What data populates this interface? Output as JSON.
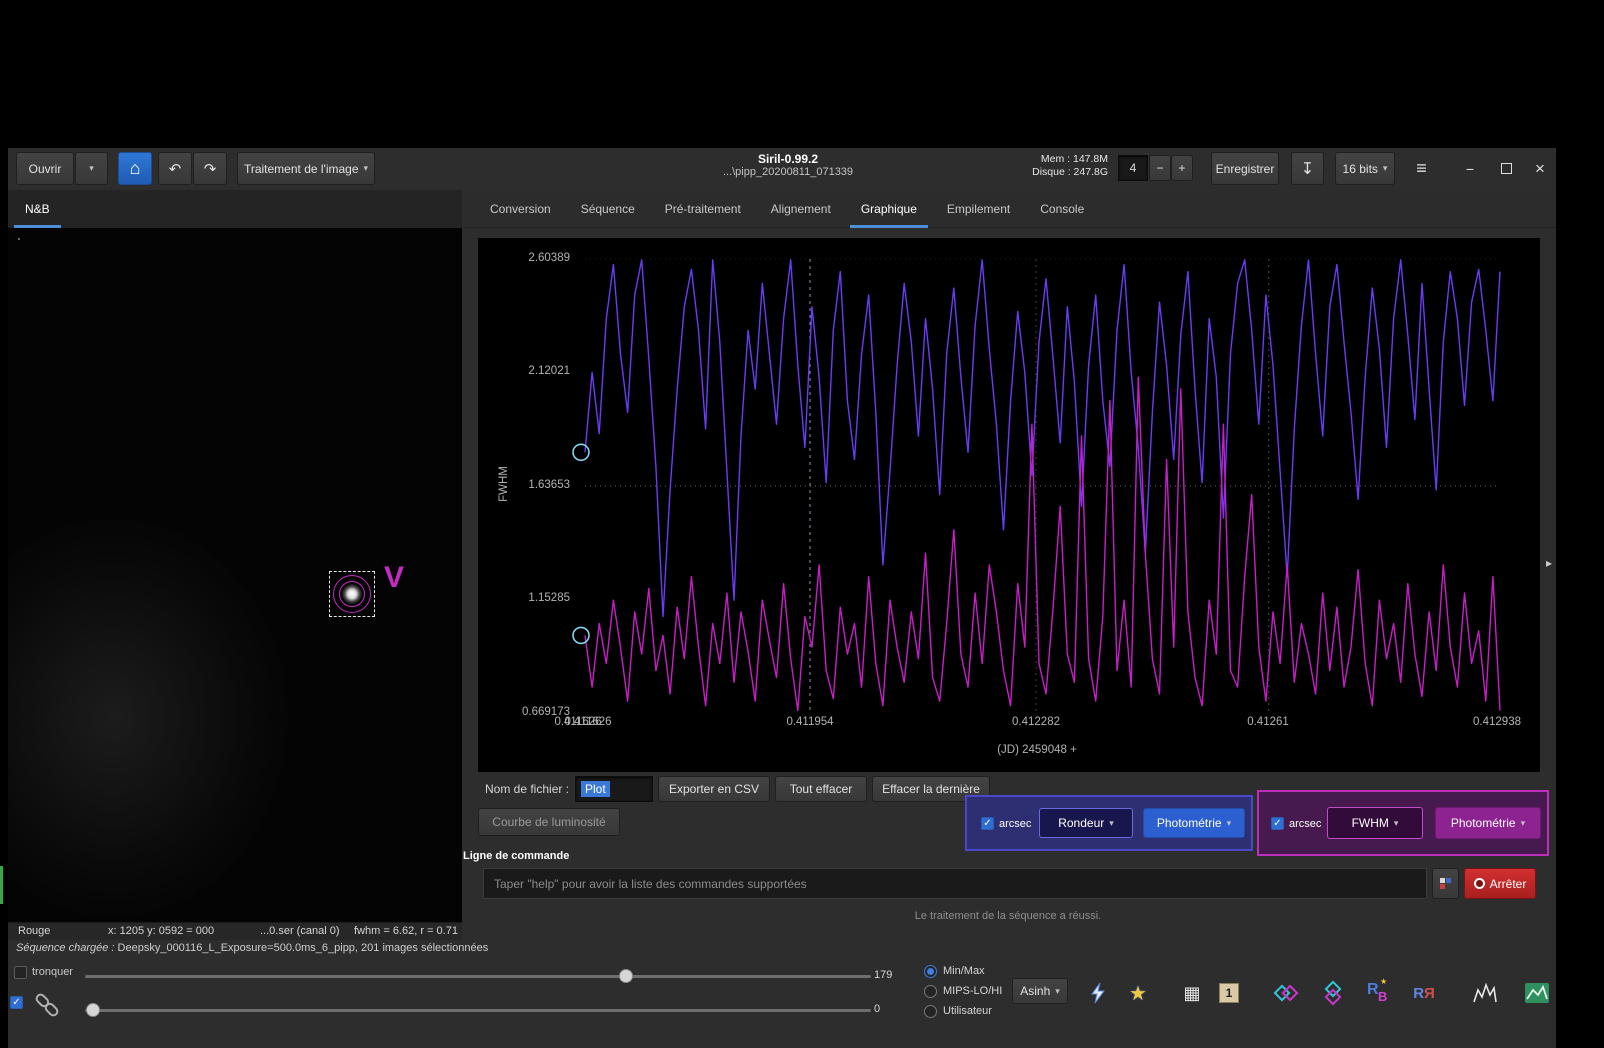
{
  "icons": {
    "caret": "▾",
    "home": "⌂",
    "undo": "↶",
    "redo": "↷",
    "export": "↧",
    "menu": "≡",
    "close": "×",
    "check": "✓",
    "star": "★",
    "grid": "▦",
    "expander": "▸",
    "minus": "−",
    "plus": "+",
    "frame_one": "1",
    "letter_r": "R",
    "letter_b": "B",
    "letter_r_mirrored": "Я"
  },
  "toolbar": {
    "open_label": "Ouvrir",
    "processing_label": "Traitement de l'image",
    "title": "Siril-0.99.2",
    "subtitle": "...\\pipp_20200811_071339",
    "mem": "Mem : 147.8M",
    "disk": "Disque : 247.8G",
    "spin_value": "4",
    "save_label": "Enregistrer",
    "bits_label": "16 bits"
  },
  "left_panel": {
    "tab_label": "N&B",
    "star_annotation": "V",
    "status_channel": "Rouge",
    "status_coords": "x: 1205 y: 0592 = 000",
    "status_file": "...0.ser (canal 0)",
    "status_fwhm": "fwhm = 6.62, r = 0.71",
    "sequence_prefix": "Séquence chargée :",
    "sequence_text": "Deepsky_000116_L_Exposure=500.0ms_6_pipp, 201 images sélectionnées"
  },
  "tabs": [
    "Conversion",
    "Séquence",
    "Pré-traitement",
    "Alignement",
    "Graphique",
    "Empilement",
    "Console"
  ],
  "chart_data": {
    "type": "line",
    "title": "",
    "xlabel": "(JD) 2459048 +",
    "ylabel": "FWHM",
    "x_ticks": [
      "0.411626",
      "0.411954",
      "0.412282",
      "0.41261",
      "0.412938"
    ],
    "y_ticks": [
      "2.60389",
      "2.12021",
      "1.63653",
      "1.15285",
      "0.669173"
    ],
    "xlim": [
      0.411626,
      0.412938
    ],
    "ylim": [
      0.669173,
      2.60389
    ],
    "grid": "dotted",
    "legend_position": "none",
    "marker_color": "#86d4ee",
    "series": [
      {
        "name": "FWHM",
        "color": "#6a3cf5",
        "values": [
          1.78,
          2.12,
          1.86,
          2.35,
          2.58,
          2.2,
          1.95,
          2.45,
          2.6,
          2.18,
          1.72,
          1.08,
          1.62,
          2.05,
          2.4,
          2.56,
          2.3,
          1.88,
          2.6,
          2.25,
          1.7,
          1.15,
          1.85,
          2.3,
          2.05,
          2.5,
          2.2,
          1.9,
          2.35,
          2.6,
          2.15,
          1.8,
          2.4,
          2.1,
          1.65,
          2.3,
          2.55,
          2.0,
          1.75,
          2.2,
          2.45,
          1.95,
          1.3,
          1.7,
          2.15,
          2.5,
          2.25,
          1.85,
          2.35,
          2.05,
          1.6,
          2.2,
          2.48,
          2.1,
          1.78,
          2.32,
          2.6,
          2.22,
          1.9,
          1.45,
          2.0,
          2.38,
          2.12,
          1.68,
          2.25,
          2.52,
          2.18,
          1.82,
          2.4,
          2.08,
          1.55,
          2.15,
          2.45,
          2.0,
          1.72,
          2.3,
          2.58,
          2.12,
          1.8,
          1.35,
          1.95,
          2.42,
          2.15,
          1.75,
          2.28,
          2.55,
          2.05,
          1.65,
          2.35,
          2.1,
          1.5,
          2.2,
          2.5,
          2.6,
          2.3,
          1.9,
          2.45,
          2.15,
          1.7,
          1.25,
          1.88,
          2.32,
          2.6,
          2.2,
          1.85,
          2.4,
          2.58,
          2.25,
          1.95,
          1.58,
          2.1,
          2.48,
          2.22,
          1.8,
          2.35,
          2.6,
          2.28,
          1.92,
          2.5,
          2.05,
          1.62,
          2.25,
          2.55,
          2.35,
          1.98,
          2.42,
          2.56,
          2.3,
          2.0,
          2.55
        ]
      },
      {
        "name": "Rondeur",
        "color": "#c81ec8",
        "values": [
          1.0,
          0.78,
          1.05,
          0.88,
          1.15,
          0.95,
          0.72,
          1.1,
          0.92,
          1.2,
          0.85,
          1.0,
          0.75,
          1.12,
          0.9,
          1.25,
          0.95,
          0.7,
          1.05,
          0.88,
          1.18,
          0.8,
          1.1,
          0.93,
          0.72,
          1.15,
          0.98,
          0.82,
          1.22,
          0.9,
          0.68,
          1.08,
          0.95,
          1.3,
          0.85,
          0.73,
          1.12,
          0.92,
          1.05,
          0.78,
          1.25,
          0.88,
          0.7,
          1.15,
          0.95,
          0.8,
          1.1,
          0.9,
          1.35,
          0.82,
          0.72,
          1.05,
          1.45,
          0.92,
          0.78,
          1.18,
          0.88,
          1.3,
          1.1,
          0.85,
          0.7,
          1.22,
          0.95,
          1.9,
          0.88,
          0.75,
          1.12,
          1.55,
          0.92,
          0.8,
          1.85,
          0.9,
          0.72,
          1.08,
          2.0,
          0.85,
          1.15,
          0.78,
          2.1,
          1.35,
          0.9,
          0.75,
          1.75,
          0.95,
          2.05,
          1.1,
          0.82,
          0.7,
          1.15,
          0.92,
          1.9,
          0.85,
          0.78,
          1.25,
          1.6,
          0.95,
          0.72,
          1.1,
          0.88,
          1.3,
          0.8,
          1.05,
          0.92,
          0.75,
          1.18,
          0.85,
          1.12,
          0.78,
          0.95,
          1.28,
          0.88,
          0.7,
          1.15,
          0.9,
          1.05,
          0.8,
          1.22,
          0.92,
          0.74,
          1.1,
          0.85,
          1.3,
          0.95,
          0.78,
          1.18,
          0.88,
          1.02,
          0.72,
          1.25,
          0.68
        ]
      }
    ]
  },
  "plot_controls": {
    "filename_label": "Nom de fichier :",
    "filename_value": "Plot",
    "export_csv_label": "Exporter en CSV",
    "clear_all_label": "Tout effacer",
    "clear_last_label": "Effacer la dernière",
    "light_curve_label": "Courbe de luminosité"
  },
  "series_panels": {
    "blue_arcsec_label": "arcsec",
    "blue_metric": "Rondeur",
    "blue_source": "Photométrie",
    "purple_arcsec_label": "arcsec",
    "purple_metric": "FWHM",
    "purple_source": "Photométrie"
  },
  "command": {
    "label": "Ligne de commande",
    "placeholder": "Taper \"help\" pour avoir la liste des commandes supportées",
    "stop_label": "Arrêter",
    "status_message": "Le traitement de la séquence a réussi."
  },
  "bottom_bar": {
    "truncate_label": "tronquer",
    "slider1_value": "179",
    "slider2_value": "0",
    "radio_minmax": "Min/Max",
    "radio_mips": "MIPS-LO/HI",
    "radio_user": "Utilisateur",
    "stretch_label": "Asinh"
  }
}
